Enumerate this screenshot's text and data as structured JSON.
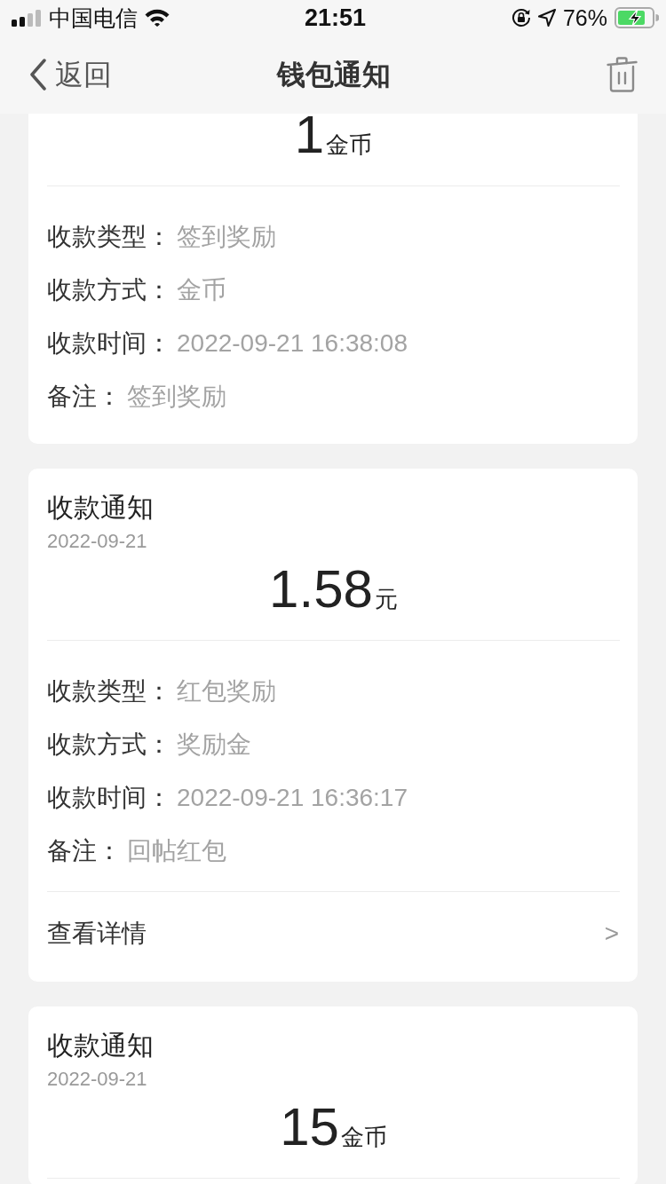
{
  "status_bar": {
    "carrier": "中国电信",
    "time": "21:51",
    "battery": "76%"
  },
  "nav_bar": {
    "back_label": "返回",
    "title": "钱包通知"
  },
  "notifications": [
    {
      "amount": "1",
      "unit": "金币",
      "fields": [
        {
          "label": "收款类型：",
          "value": "签到奖励"
        },
        {
          "label": "收款方式：",
          "value": "金币"
        },
        {
          "label": "收款时间：",
          "value": "2022-09-21 16:38:08"
        },
        {
          "label": "备注：",
          "value": "签到奖励"
        }
      ]
    },
    {
      "title": "收款通知",
      "date": "2022-09-21",
      "amount": "1.58",
      "unit": "元",
      "fields": [
        {
          "label": "收款类型：",
          "value": "红包奖励"
        },
        {
          "label": "收款方式：",
          "value": "奖励金"
        },
        {
          "label": "收款时间：",
          "value": "2022-09-21 16:36:17"
        },
        {
          "label": "备注：",
          "value": "回帖红包"
        }
      ],
      "details_link": "查看详情",
      "details_arrow": ">"
    },
    {
      "title": "收款通知",
      "date": "2022-09-21",
      "amount": "15",
      "unit": "金币"
    }
  ]
}
